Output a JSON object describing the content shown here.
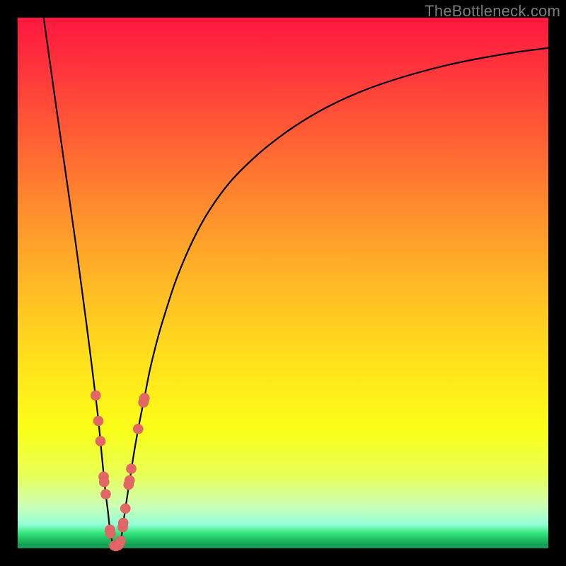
{
  "watermark": "TheBottleneck.com",
  "colors": {
    "frame": "#000000",
    "curve_stroke": "#000000",
    "marker_fill": "#e46767",
    "marker_stroke": "#d85a5a"
  },
  "chart_data": {
    "type": "line",
    "title": "",
    "xlabel": "",
    "ylabel": "",
    "xlim": [
      0,
      100
    ],
    "ylim": [
      0,
      100
    ],
    "series": [
      {
        "name": "bottleneck-curve",
        "x": [
          4.9,
          7,
          9,
          11,
          13,
          15,
          15.9,
          16.5,
          17,
          17.4,
          18,
          18.5,
          19.2,
          19.6,
          20,
          20.6,
          21.3,
          22,
          23,
          24,
          25,
          26.5,
          28,
          30,
          33,
          36,
          40,
          45,
          50,
          55,
          60,
          65,
          70,
          76,
          82,
          88,
          94,
          100
        ],
        "y": [
          100,
          85,
          71,
          57,
          42,
          26,
          17,
          11,
          7,
          3.5,
          0.6,
          0.4,
          0.8,
          2.5,
          5.5,
          9.5,
          14,
          18.5,
          24,
          29,
          34,
          40,
          45,
          51,
          58,
          63.5,
          69,
          74,
          78,
          81.3,
          84,
          86.2,
          88,
          89.8,
          91.3,
          92.5,
          93.5,
          94.3
        ]
      }
    ],
    "markers": [
      {
        "x": 14.7,
        "y": 28.8
      },
      {
        "x": 15.2,
        "y": 24
      },
      {
        "x": 15.6,
        "y": 20.2
      },
      {
        "x": 16.2,
        "y": 13.5
      },
      {
        "x": 16.3,
        "y": 12.5
      },
      {
        "x": 16.6,
        "y": 10.2
      },
      {
        "x": 17.4,
        "y": 3.5
      },
      {
        "x": 17.5,
        "y": 2.8
      },
      {
        "x": 18.2,
        "y": 0.5
      },
      {
        "x": 18.5,
        "y": 0.4
      },
      {
        "x": 19.0,
        "y": 0.6
      },
      {
        "x": 19.2,
        "y": 0.9
      },
      {
        "x": 19.4,
        "y": 1.4
      },
      {
        "x": 19.8,
        "y": 4.0
      },
      {
        "x": 19.9,
        "y": 4.8
      },
      {
        "x": 20.3,
        "y": 7.5
      },
      {
        "x": 21.1,
        "y": 12.8
      },
      {
        "x": 20.9,
        "y": 12.0
      },
      {
        "x": 21.4,
        "y": 15.0
      },
      {
        "x": 22.7,
        "y": 22.5
      },
      {
        "x": 23.7,
        "y": 27.5
      },
      {
        "x": 23.9,
        "y": 28.3
      }
    ],
    "marker_radius_px": 7
  }
}
